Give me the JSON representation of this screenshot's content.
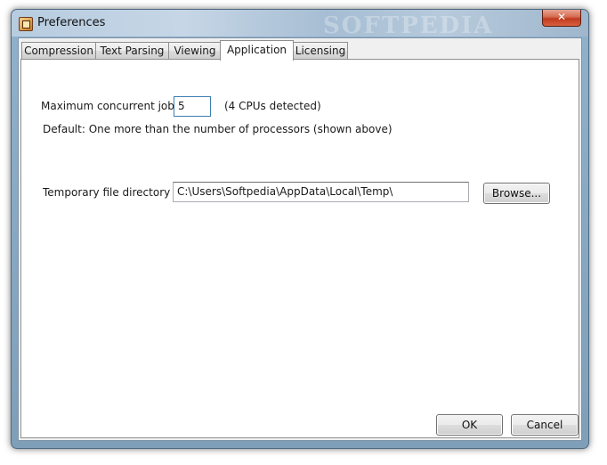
{
  "window": {
    "title": "Preferences",
    "watermark": "SOFTPEDIA",
    "close_glyph": "✕"
  },
  "tabs": [
    {
      "label": "Compression"
    },
    {
      "label": "Text Parsing"
    },
    {
      "label": "Viewing"
    },
    {
      "label": "Application",
      "active": true
    },
    {
      "label": "Licensing"
    }
  ],
  "application": {
    "max_jobs_label": "Maximum concurrent jobs",
    "max_jobs_value": "5",
    "cpus_detected": "(4 CPUs detected)",
    "default_note": "Default:  One more than the number of processors (shown above)",
    "temp_dir_label": "Temporary file directory",
    "temp_dir_value": "C:\\Users\\Softpedia\\AppData\\Local\\Temp\\",
    "browse_label": "Browse..."
  },
  "footer": {
    "ok_label": "OK",
    "cancel_label": "Cancel"
  }
}
